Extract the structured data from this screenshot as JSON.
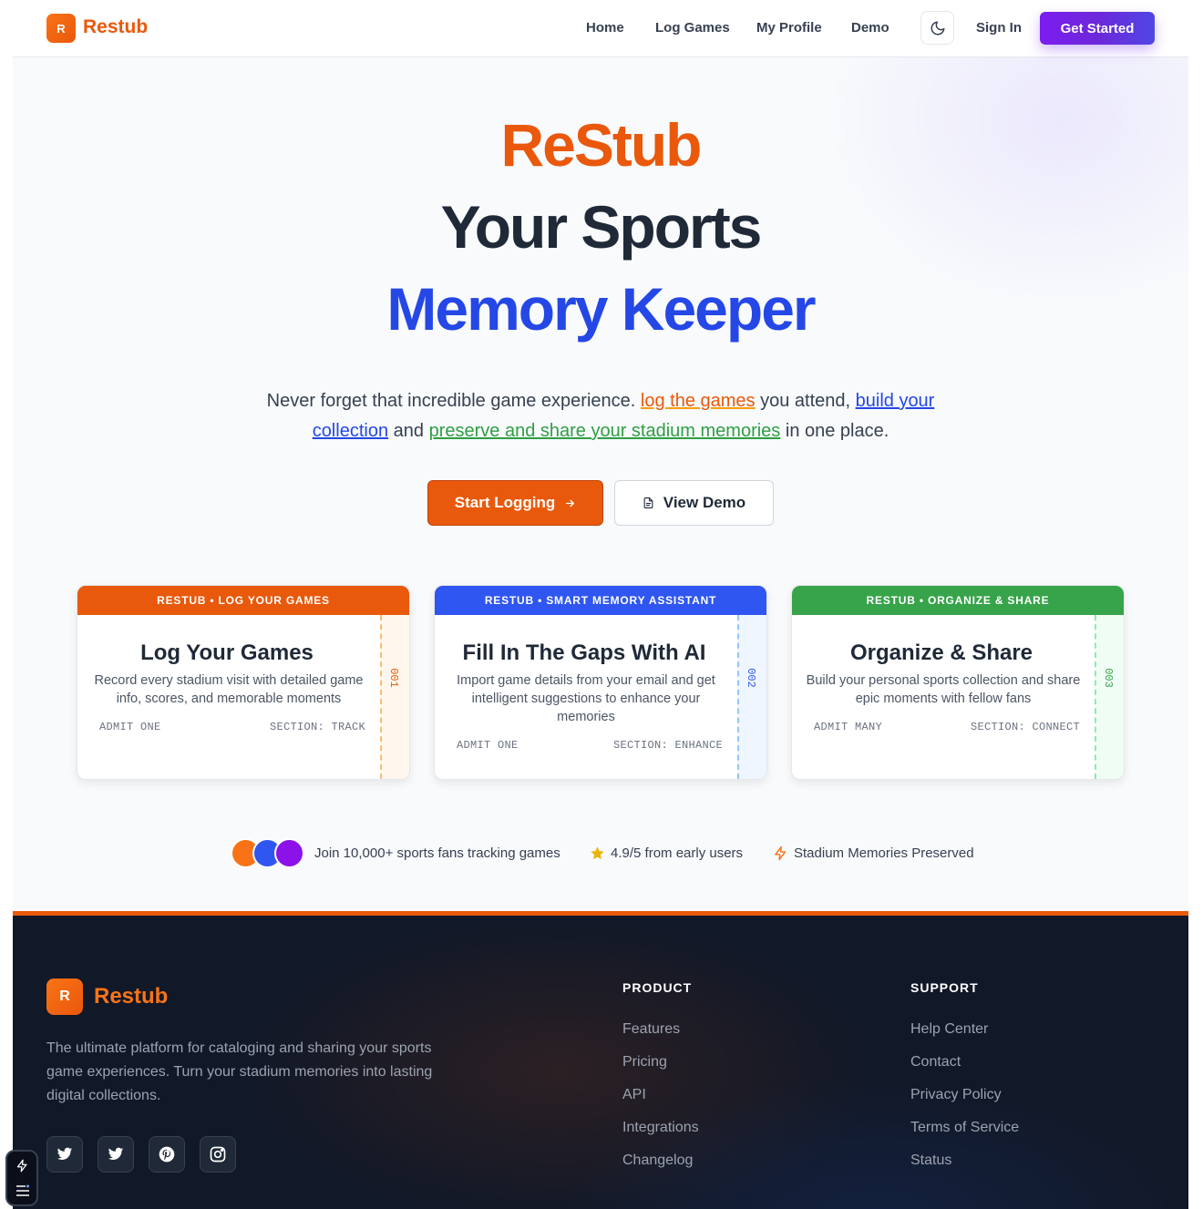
{
  "brand": {
    "logo_letter": "R",
    "name": "Restub"
  },
  "nav": {
    "home": "Home",
    "log_games": "Log Games",
    "my_profile": "My Profile",
    "demo": "Demo",
    "sign_in": "Sign In",
    "get_started": "Get Started"
  },
  "hero": {
    "line1": "ReStub",
    "line2": "Your Sports",
    "line3": "Memory Keeper",
    "sub_1": "Never forget that incredible game experience.",
    "sub_link1": "log the games",
    "sub_2": "you attend,",
    "sub_link2": "build your collection",
    "sub_3": "and",
    "sub_link3": "preserve and share your stadium memories",
    "sub_4": "in one place.",
    "cta_primary": "Start Logging",
    "cta_secondary": "View Demo"
  },
  "cards": [
    {
      "band": "RESTUB • LOG YOUR GAMES",
      "title": "Log Your Games",
      "desc": "Record every stadium visit with detailed game info, scores, and memorable moments",
      "admit": "ADMIT ONE",
      "section": "SECTION: TRACK",
      "num": "001",
      "color": "#e8590c",
      "stub_bg": "#fff7ed",
      "stub_line": "#fdba74"
    },
    {
      "band": "RESTUB • SMART MEMORY ASSISTANT",
      "title": "Fill In The Gaps With AI",
      "desc": "Import game details from your email and get intelligent suggestions to enhance your memories",
      "admit": "ADMIT ONE",
      "section": "SECTION: ENHANCE",
      "num": "002",
      "color": "#2f56f0",
      "stub_bg": "#eff6ff",
      "stub_line": "#93c5fd"
    },
    {
      "band": "RESTUB • ORGANIZE & SHARE",
      "title": "Organize & Share",
      "desc": "Build your personal sports collection and share epic moments with fellow fans",
      "admit": "ADMIT MANY",
      "section": "SECTION: CONNECT",
      "num": "003",
      "color": "#37a34a",
      "stub_bg": "#f0fdf4",
      "stub_line": "#86efac"
    }
  ],
  "trust": {
    "fans": "Join 10,000+ sports fans tracking games",
    "rating": "4.9/5 from early users",
    "memories": "Stadium Memories Preserved"
  },
  "footer": {
    "logo_letter": "R",
    "name": "Restub",
    "description": "The ultimate platform for cataloging and sharing your sports game experiences. Turn your stadium memories into lasting digital collections.",
    "social": [
      "twitter-icon",
      "twitter-icon",
      "pinterest-icon",
      "instagram-icon"
    ],
    "product_heading": "PRODUCT",
    "product_links": [
      "Features",
      "Pricing",
      "API",
      "Integrations",
      "Changelog"
    ],
    "support_heading": "SUPPORT",
    "support_links": [
      "Help Center",
      "Contact",
      "Privacy Policy",
      "Terms of Service",
      "Status"
    ]
  }
}
